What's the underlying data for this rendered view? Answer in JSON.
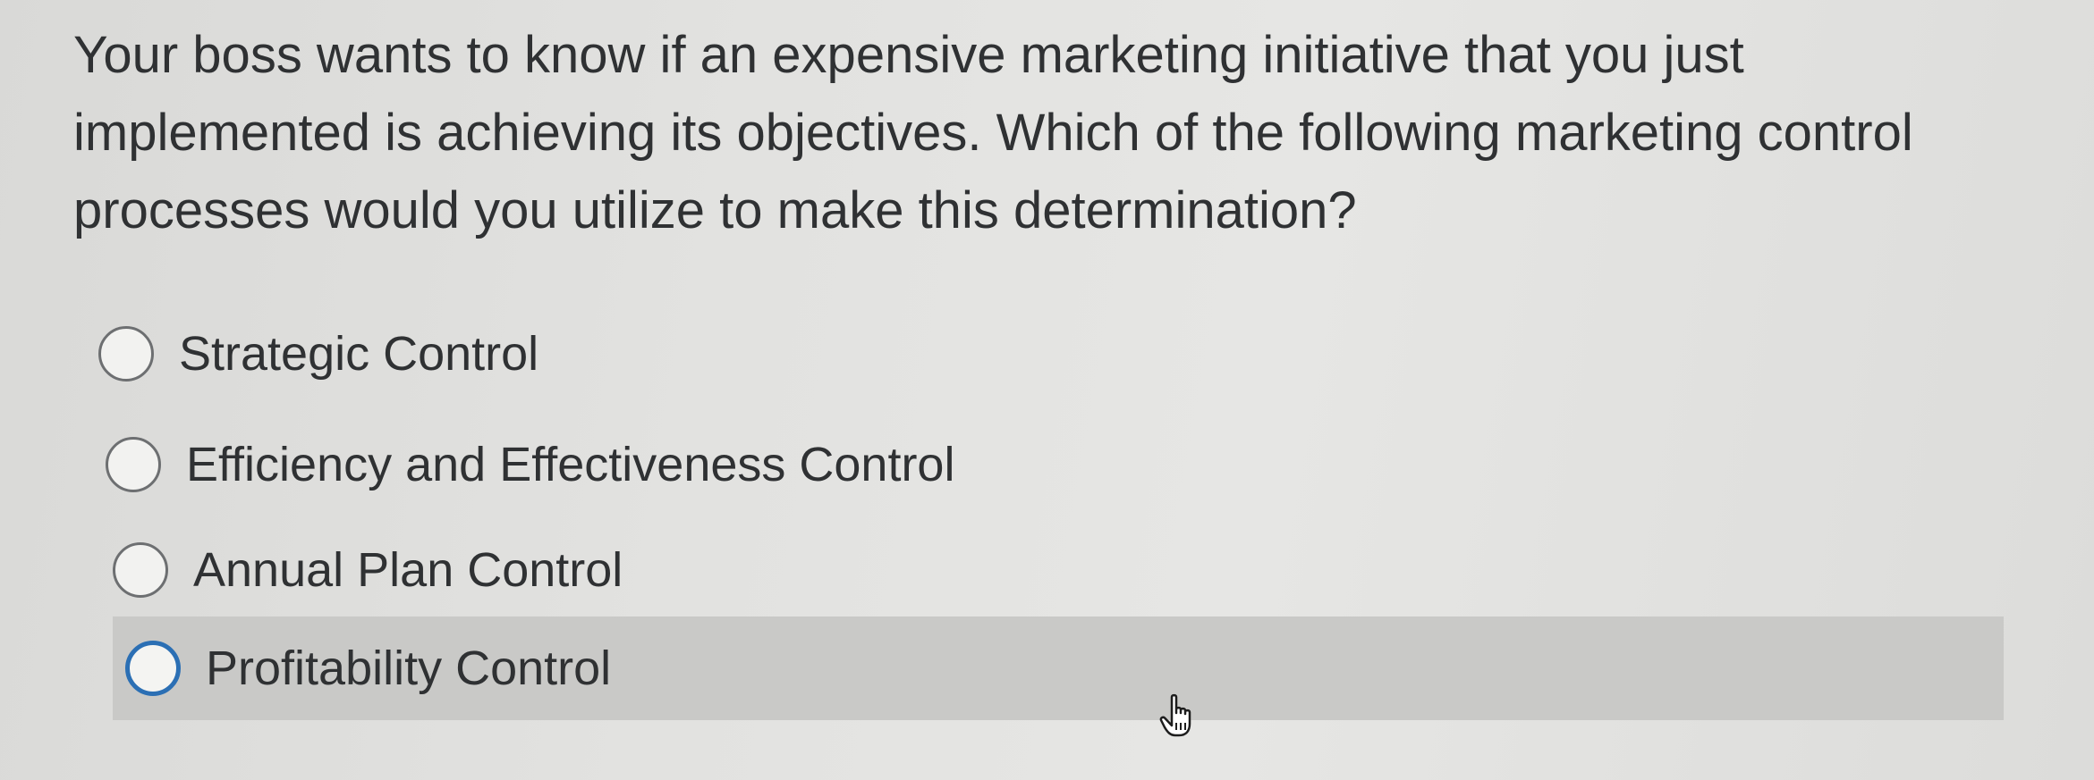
{
  "question": {
    "lines": [
      "Your boss wants to know if an expensive marketing initiative that you just",
      "implemented is achieving its objectives.  Which of the following marketing control",
      "processes would you utilize to make this determination?"
    ]
  },
  "options": [
    {
      "label": "Strategic Control",
      "selected": false,
      "hovered": false
    },
    {
      "label": "Efficiency and Effectiveness Control",
      "selected": false,
      "hovered": false
    },
    {
      "label": "Annual Plan Control",
      "selected": false,
      "hovered": false
    },
    {
      "label": "Profitability Control",
      "selected": false,
      "hovered": true
    }
  ],
  "colors": {
    "focus_ring": "#2b6fb4",
    "hover_row": "#c9c9c7",
    "text": "#2f3133"
  },
  "cursor": {
    "icon": "hand-pointer-icon"
  }
}
